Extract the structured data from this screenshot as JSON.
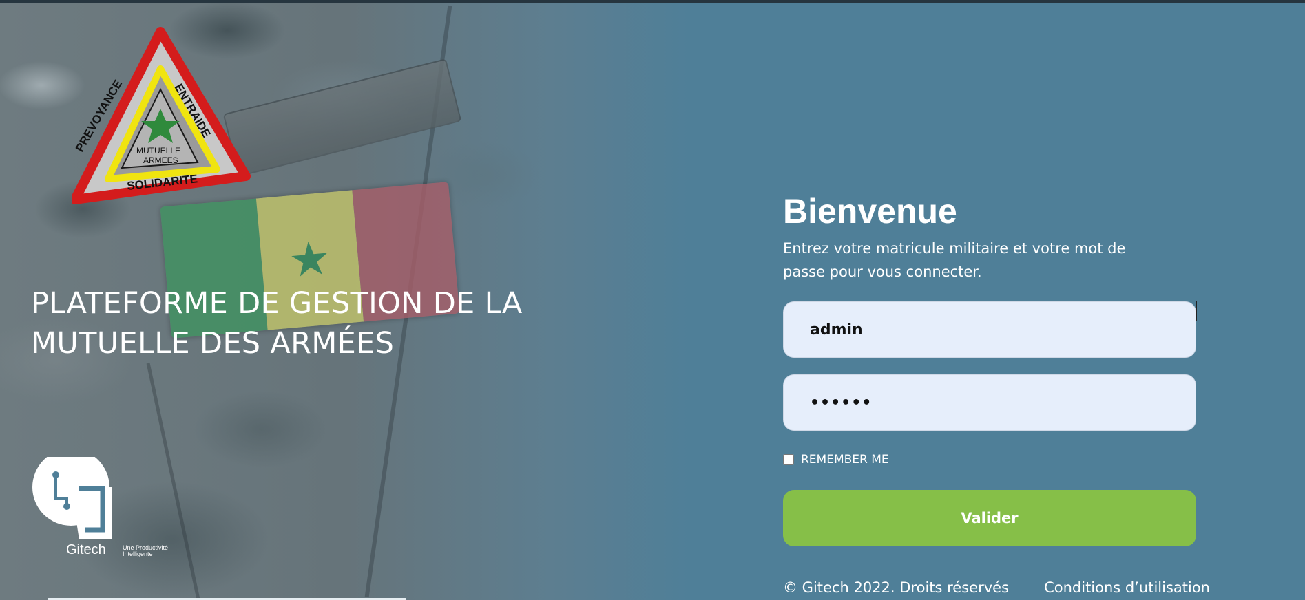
{
  "brand": {
    "emblem_words": [
      "PREVOYANCE",
      "ENTRAIDE",
      "SOLIDARITE",
      "MUTUELLE",
      "ARMEES"
    ],
    "headline": "PLATEFORME DE GESTION DE LA MUTUELLE DES ARMÉES",
    "company": "Gitech",
    "tagline": "Une Productivité Intelligente"
  },
  "login": {
    "title": "Bienvenue",
    "subtitle": "Entrez votre matricule militaire et votre mot de passe pour vous connecter.",
    "username_value": "admin",
    "password_value": "••••••",
    "remember_label": "REMEMBER ME",
    "submit_label": "Valider"
  },
  "footer": {
    "copyright": "© Gitech 2022. Droits réservés",
    "terms": "Conditions d’utilisation"
  },
  "colors": {
    "background": "#4f7f98",
    "input_bg": "#e6eefb",
    "submit_bg": "#86bf48",
    "text": "#ffffff"
  }
}
